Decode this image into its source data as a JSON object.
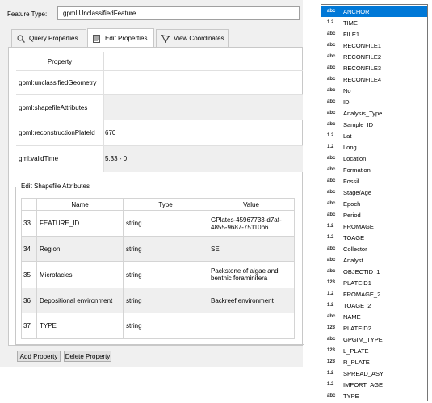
{
  "feature_type": {
    "label": "Feature Type:",
    "value": "gpml:UnclassifiedFeature"
  },
  "tabs": [
    {
      "label": "Query Properties",
      "icon": "query-icon"
    },
    {
      "label": "Edit Properties",
      "icon": "edit-icon"
    },
    {
      "label": "View Coordinates",
      "icon": "coordinates-icon"
    }
  ],
  "properties": {
    "header": "Property",
    "rows": [
      {
        "name": "gpml:unclassifiedGeometry",
        "value": ""
      },
      {
        "name": "gpml:shapefileAttributes",
        "value": ""
      },
      {
        "name": "gpml:reconstructionPlateId",
        "value": "670"
      },
      {
        "name": "gml:validTime",
        "value": "5.33 - 0"
      }
    ]
  },
  "shapefile": {
    "group_label": "Edit Shapefile Attributes",
    "columns": [
      "Name",
      "Type",
      "Value"
    ],
    "rows": [
      {
        "num": "33",
        "name": "FEATURE_ID",
        "type": "string",
        "value": "GPlates-45967733-d7af-4855-9687-75110b6..."
      },
      {
        "num": "34",
        "name": "Region",
        "type": "string",
        "value": "SE"
      },
      {
        "num": "35",
        "name": "Microfacies",
        "type": "string",
        "value": "Packstone of algae and benthic foraminifera"
      },
      {
        "num": "36",
        "name": "Depositional environment",
        "type": "string",
        "value": "Backreef environment"
      },
      {
        "num": "37",
        "name": "TYPE",
        "type": "string",
        "value": ""
      }
    ]
  },
  "buttons": {
    "add": "Add Property",
    "delete": "Delete Property"
  },
  "dropdown": {
    "items": [
      {
        "type": "abc",
        "name": "ANCHOR",
        "selected": true
      },
      {
        "type": "1.2",
        "name": "TIME"
      },
      {
        "type": "abc",
        "name": "FILE1"
      },
      {
        "type": "abc",
        "name": "RECONFILE1"
      },
      {
        "type": "abc",
        "name": "RECONFILE2"
      },
      {
        "type": "abc",
        "name": "RECONFILE3"
      },
      {
        "type": "abc",
        "name": "RECONFILE4"
      },
      {
        "type": "abc",
        "name": "No"
      },
      {
        "type": "abc",
        "name": "ID"
      },
      {
        "type": "abc",
        "name": "Analysis_Type"
      },
      {
        "type": "abc",
        "name": "Sample_ID"
      },
      {
        "type": "1.2",
        "name": "Lat"
      },
      {
        "type": "1.2",
        "name": "Long"
      },
      {
        "type": "abc",
        "name": "Location"
      },
      {
        "type": "abc",
        "name": "Formation"
      },
      {
        "type": "abc",
        "name": "Fossil"
      },
      {
        "type": "abc",
        "name": "Stage/Age"
      },
      {
        "type": "abc",
        "name": "Epoch"
      },
      {
        "type": "abc",
        "name": "Period"
      },
      {
        "type": "1.2",
        "name": "FROMAGE"
      },
      {
        "type": "1.2",
        "name": "TOAGE"
      },
      {
        "type": "abc",
        "name": "Collector"
      },
      {
        "type": "abc",
        "name": "Analyst"
      },
      {
        "type": "abc",
        "name": "OBJECTID_1"
      },
      {
        "type": "123",
        "name": "PLATEID1"
      },
      {
        "type": "1.2",
        "name": "FROMAGE_2"
      },
      {
        "type": "1.2",
        "name": "TOAGE_2"
      },
      {
        "type": "abc",
        "name": "NAME"
      },
      {
        "type": "123",
        "name": "PLATEID2"
      },
      {
        "type": "abc",
        "name": "GPGIM_TYPE"
      },
      {
        "type": "123",
        "name": "L_PLATE"
      },
      {
        "type": "123",
        "name": "R_PLATE"
      },
      {
        "type": "1.2",
        "name": "SPREAD_ASY"
      },
      {
        "type": "1.2",
        "name": "IMPORT_AGE"
      },
      {
        "type": "abc",
        "name": "TYPE"
      }
    ]
  }
}
